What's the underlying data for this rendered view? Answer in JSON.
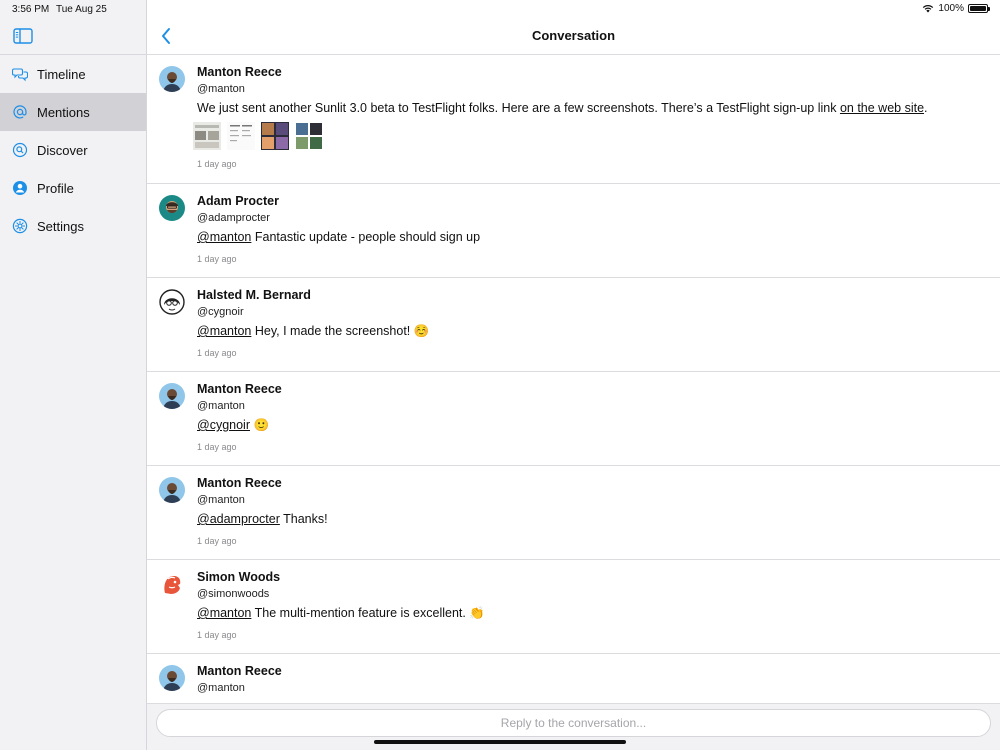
{
  "status_bar": {
    "time": "3:56 PM",
    "date": "Tue Aug 25",
    "battery": "100%"
  },
  "sidebar": {
    "items": [
      {
        "label": "Timeline",
        "icon": "speech-bubbles-icon",
        "selected": false
      },
      {
        "label": "Mentions",
        "icon": "at-sign-icon",
        "selected": true
      },
      {
        "label": "Discover",
        "icon": "magnifier-icon",
        "selected": false
      },
      {
        "label": "Profile",
        "icon": "person-icon",
        "selected": false
      },
      {
        "label": "Settings",
        "icon": "gear-icon",
        "selected": false
      }
    ]
  },
  "header": {
    "title": "Conversation"
  },
  "posts": [
    {
      "name": "Manton Reece",
      "handle": "@manton",
      "text": "We just sent another Sunlit 3.0 beta to TestFlight folks. Here are a few screenshots. There’s a TestFlight sign-up link ",
      "link": "on the web site",
      "text_end": ".",
      "time": "1 day ago"
    },
    {
      "name": "Adam Procter",
      "handle": "@adamprocter",
      "mention": "@manton",
      "text": " Fantastic update - people should sign up",
      "time": "1 day ago"
    },
    {
      "name": "Halsted M. Bernard",
      "handle": "@cygnoir",
      "mention": "@manton",
      "text": " Hey, I made the screenshot! ☺️",
      "time": "1 day ago"
    },
    {
      "name": "Manton Reece",
      "handle": "@manton",
      "mention": "@cygnoir",
      "text": " 🙂",
      "time": "1 day ago"
    },
    {
      "name": "Manton Reece",
      "handle": "@manton",
      "mention": "@adamprocter",
      "text": " Thanks!",
      "time": "1 day ago"
    },
    {
      "name": "Simon Woods",
      "handle": "@simonwoods",
      "mention": "@manton",
      "text": " The multi-mention feature is excellent. 👏",
      "time": "1 day ago"
    },
    {
      "name": "Manton Reece",
      "handle": "@manton"
    }
  ],
  "reply": {
    "placeholder": "Reply to the conversation..."
  },
  "colors": {
    "accent": "#1e8fe6",
    "selected_bg": "#d1d1d6",
    "sidebar_bg": "#f2f2f4"
  }
}
